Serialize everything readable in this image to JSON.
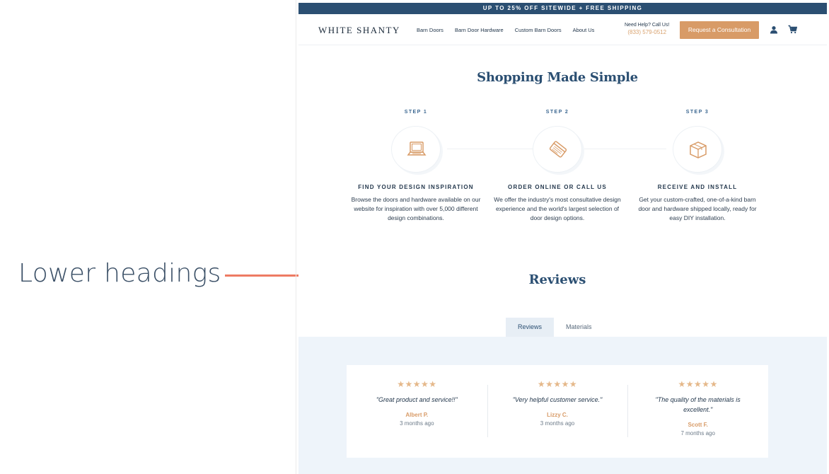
{
  "annotation": {
    "label": "Lower headings",
    "arrow_color": "#ee7b63"
  },
  "promo": {
    "text": "UP TO 25% OFF SITEWIDE + FREE SHIPPING"
  },
  "header": {
    "logo": "WHITE SHANTY",
    "nav": [
      "Barn Doors",
      "Barn Door Hardware",
      "Custom Barn Doors",
      "About Us"
    ],
    "help_label": "Need Help? Call Us!",
    "phone": "(833) 579-0512",
    "cta": "Request a Consultation",
    "icons": [
      "user-icon",
      "cart-icon"
    ]
  },
  "shopping": {
    "heading": "Shopping Made Simple",
    "steps": [
      {
        "label": "STEP 1",
        "icon": "laptop-icon",
        "title": "FIND YOUR DESIGN INSPIRATION",
        "desc": "Browse the doors and hardware available on our website for inspiration with over 5,000 different design combinations."
      },
      {
        "label": "STEP 2",
        "icon": "credit-card-icon",
        "title": "ORDER ONLINE OR CALL US",
        "desc": "We offer the industry's most consultative design experience and the world's largest selection of door design options."
      },
      {
        "label": "STEP 3",
        "icon": "package-icon",
        "title": "RECEIVE AND INSTALL",
        "desc": "Get your custom-crafted, one-of-a-kind barn door and hardware shipped locally, ready for easy DIY installation."
      }
    ]
  },
  "reviews": {
    "heading": "Reviews",
    "tabs": [
      {
        "label": "Reviews",
        "active": true
      },
      {
        "label": "Materials",
        "active": false
      }
    ],
    "stars": "★★★★★",
    "rating": 5,
    "items": [
      {
        "quote": "\"Great product and service!!\"",
        "author": "Albert P.",
        "when": "3 months ago"
      },
      {
        "quote": "\"Very helpful customer service.\"",
        "author": "Lizzy C.",
        "when": "3 months ago"
      },
      {
        "quote": "\"The quality of the materials is excellent.\"",
        "author": "Scott F.",
        "when": "7 months ago"
      }
    ]
  },
  "colors": {
    "navy": "#2b4f72",
    "accent": "#d89b67",
    "review_bg": "#eef4fa"
  }
}
